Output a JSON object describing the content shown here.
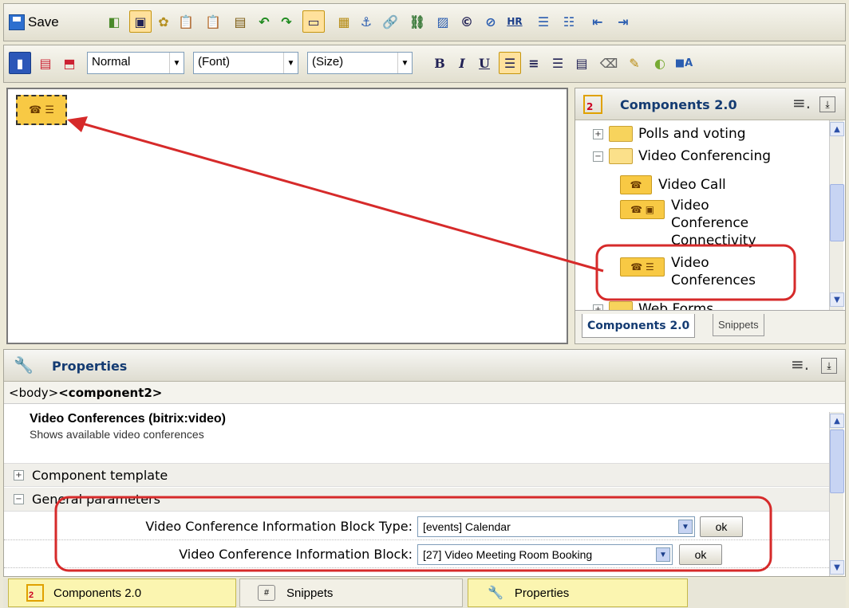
{
  "toolbar": {
    "save_label": "Save",
    "hr_label": "HR",
    "style_value": "Normal",
    "font_value": "(Font)",
    "size_value": "(Size)",
    "bold": "B",
    "italic": "I",
    "underline": "U"
  },
  "components_panel": {
    "title": "Components 2.0",
    "tree": [
      {
        "label": "Polls and voting",
        "type": "folder",
        "expander": "+"
      },
      {
        "label": "Video Conferencing",
        "type": "folder-open",
        "expander": "−"
      },
      {
        "label": "Video Call",
        "type": "component"
      },
      {
        "label": "Video Conference Connectivity",
        "type": "component"
      },
      {
        "label": "Video Conferences",
        "type": "component"
      },
      {
        "label": "Web Forms",
        "type": "folder",
        "expander": "+"
      }
    ],
    "tabs": [
      "Components 2.0",
      "Snippets"
    ]
  },
  "properties_panel": {
    "title": "Properties",
    "breadcrumb_body": "<body>",
    "breadcrumb_component": "<component2>",
    "component_name": "Video Conferences (bitrix:video)",
    "component_desc": "Shows available video conferences",
    "sections": [
      {
        "label": "Component template",
        "expander": "+"
      },
      {
        "label": "General parameters",
        "expander": "−"
      }
    ],
    "params": [
      {
        "label": "Video Conference Information Block Type:",
        "value": "[events] Calendar",
        "ok": "ok"
      },
      {
        "label": "Video Conference Information Block:",
        "value": "[27] Video Meeting Room Booking",
        "ok": "ok"
      }
    ]
  },
  "bottom_tabs": [
    "Components 2.0",
    "Snippets",
    "Properties"
  ],
  "colors": {
    "highlight": "#d62a2a",
    "accent": "#ffe19c",
    "tab_yellow": "#fbf5b0"
  }
}
